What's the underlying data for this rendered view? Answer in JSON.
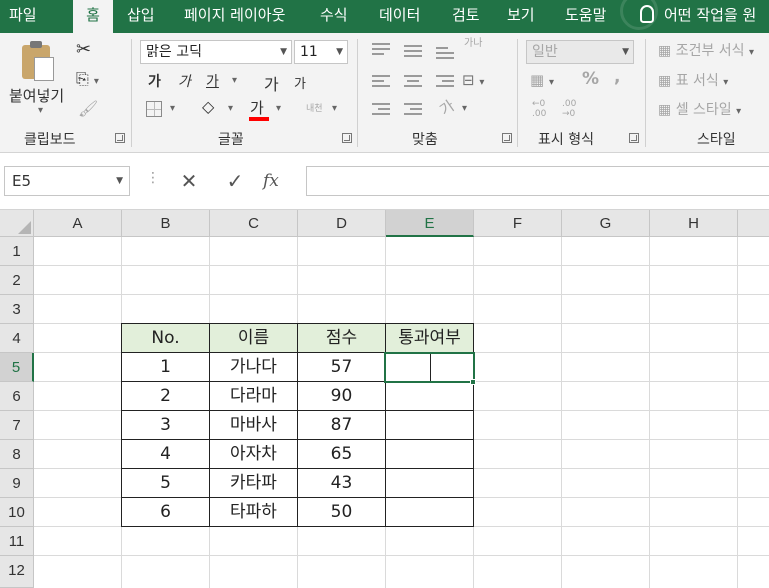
{
  "ribbon_tabs": [
    "파일",
    "홈",
    "삽입",
    "페이지 레이아웃",
    "수식",
    "데이터",
    "검토",
    "보기",
    "도움말"
  ],
  "active_tab": "홈",
  "tell_me": "어떤 작업을 원",
  "clipboard": {
    "paste_label": "붙여넣기",
    "group_label": "클립보드"
  },
  "font": {
    "name": "맑은 고딕",
    "size": "11",
    "bold": "가",
    "italic": "가",
    "underline": "가",
    "grow": "가",
    "shrink": "가",
    "font_color": "가",
    "phonetic": "내천",
    "group_label": "글꼴"
  },
  "alignment": {
    "wrap": "가나",
    "orientation": "가",
    "group_label": "맞춤"
  },
  "number": {
    "format": "일반",
    "percent": "%",
    "comma": ",",
    "inc_decimal": "←0 .00",
    "dec_decimal": ".00 →0",
    "group_label": "표시 형식"
  },
  "styles": {
    "conditional": "조건부 서식",
    "table": "표 서식",
    "cell": "셀 스타일",
    "group_label": "스타일"
  },
  "formula_bar": {
    "name_box": "E5",
    "fx": "fx",
    "content": ""
  },
  "columns": [
    "A",
    "B",
    "C",
    "D",
    "E",
    "F",
    "G",
    "H"
  ],
  "rows": [
    "1",
    "2",
    "3",
    "4",
    "5",
    "6",
    "7",
    "8",
    "9",
    "10",
    "11",
    "12"
  ],
  "selected_cell": "E5",
  "table": {
    "headers": [
      "No.",
      "이름",
      "점수",
      "통과여부"
    ],
    "rows": [
      [
        "1",
        "가나다",
        "57",
        ""
      ],
      [
        "2",
        "다라마",
        "90",
        ""
      ],
      [
        "3",
        "마바사",
        "87",
        ""
      ],
      [
        "4",
        "아자차",
        "65",
        ""
      ],
      [
        "5",
        "카타파",
        "43",
        ""
      ],
      [
        "6",
        "타파하",
        "50",
        ""
      ]
    ]
  },
  "colors": {
    "accent": "#217346",
    "header_fill": "#e2efda",
    "font_color_bar": "#ff0000"
  }
}
